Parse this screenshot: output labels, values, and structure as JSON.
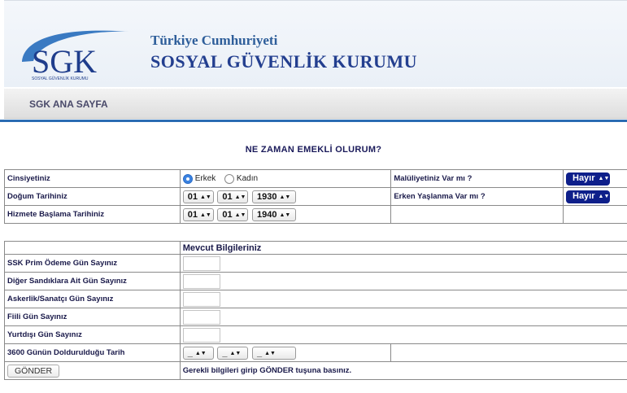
{
  "header": {
    "logo_text": "SGK",
    "logo_subtext": "SOSYAL GÜVENLİK KURUMU",
    "title_line1": "Türkiye Cumhuriyeti",
    "title_line2": "SOSYAL GÜVENLİK KURUMU"
  },
  "nav": {
    "home": "SGK ANA SAYFA"
  },
  "page_title": "NE ZAMAN EMEKLİ OLURUM?",
  "form": {
    "gender": {
      "label": "Cinsiyetiniz",
      "options": [
        "Erkek",
        "Kadın"
      ],
      "selected": "Erkek"
    },
    "disability": {
      "label": "Malüliyetiniz Var mı ?",
      "value": "Hayır"
    },
    "birth": {
      "label": "Doğum Tarihiniz",
      "day": "01",
      "month": "01",
      "year": "1930"
    },
    "early_aging": {
      "label": "Erken Yaşlanma Var mı ?",
      "value": "Hayır"
    },
    "service_start": {
      "label": "Hizmete Başlama Tarihiniz",
      "day": "01",
      "month": "01",
      "year": "1940"
    },
    "section_title": "Mevcut  Bilgileriniz",
    "fields": [
      {
        "label": "SSK Prim Ödeme Gün Sayınız",
        "value": ""
      },
      {
        "label": "Diğer Sandıklara Ait Gün Sayınız",
        "value": ""
      },
      {
        "label": "Askerlik/Sanatçı Gün Sayınız",
        "value": ""
      },
      {
        "label": "Fiili Gün Sayınız",
        "value": ""
      },
      {
        "label": "Yurtdışı Gün Sayınız",
        "value": ""
      }
    ],
    "completion_date": {
      "label": "3600 Günün Doldurulduğu Tarih",
      "day": "_",
      "month": "_",
      "year": "_"
    },
    "submit_label": "GÖNDER",
    "warning": "Gerekli bilgileri girip GÖNDER tuşuna basınız."
  },
  "colors": {
    "accent": "#2b6cb3",
    "button_dark": "#0e1f8a",
    "warning": "#d11a1a",
    "radio_on": "#3b82e0"
  }
}
